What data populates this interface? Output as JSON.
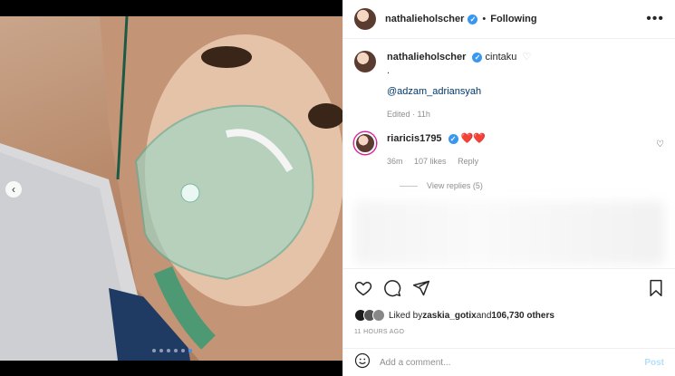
{
  "post": {
    "author": "nathalieholscher",
    "follow_status": "Following",
    "more_label": "•••",
    "separator": "•"
  },
  "caption": {
    "username": "nathalieholscher",
    "text": "cintaku",
    "dot": ".",
    "mention": "@adzam_adriansyah",
    "meta": "Edited · 11h"
  },
  "comment": {
    "username": "riaricis1795",
    "hearts": "❤️❤️",
    "time": "36m",
    "likes": "107 likes",
    "reply_label": "Reply",
    "view_replies": "View replies (5)"
  },
  "likes": {
    "prefix": "Liked by ",
    "user": "zaskia_gotix",
    "middle": " and ",
    "others": "106,730 others",
    "timestamp": "11 HOURS AGO"
  },
  "composer": {
    "placeholder": "Add a comment...",
    "post_label": "Post"
  },
  "carousel": {
    "prev_icon": "‹",
    "dots": 6,
    "active_dot": 6
  },
  "colors": {
    "verified": "#3897f0",
    "heart": "#ed4956",
    "mention": "#00376b",
    "post_button": "#b2dffc"
  }
}
